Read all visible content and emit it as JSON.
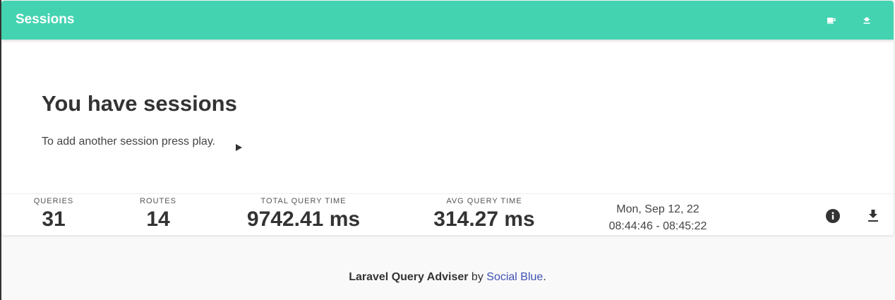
{
  "header": {
    "title": "Sessions",
    "accent_color": "#44d3b1",
    "actions": [
      {
        "icon": "coffee-icon"
      },
      {
        "icon": "upload-icon"
      }
    ]
  },
  "hero": {
    "title": "You have sessions",
    "text": "To add another session press play.",
    "play_icon": "play-icon"
  },
  "session": {
    "queries_label": "QUERIES",
    "queries_value": "31",
    "routes_label": "ROUTES",
    "routes_value": "14",
    "total_label": "TOTAL QUERY TIME",
    "total_value": "9742.41 ms",
    "avg_label": "AVG QUERY TIME",
    "avg_value": "314.27 ms",
    "date": "Mon, Sep 12, 22",
    "time_range": "08:44:46 - 08:45:22",
    "actions": [
      {
        "icon": "info-icon"
      },
      {
        "icon": "download-icon"
      }
    ]
  },
  "footer": {
    "brand": "Laravel Query Adviser",
    "by": " by ",
    "link": "Social Blue",
    "period": "."
  }
}
